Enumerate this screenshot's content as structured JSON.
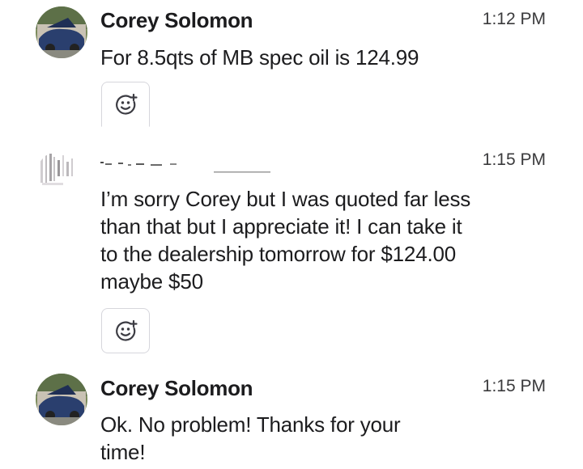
{
  "messages": [
    {
      "sender": "Corey Solomon",
      "time": "1:12 PM",
      "text": "For 8.5qts of MB spec oil is 124.99",
      "reaction_icon": "add-reaction-icon"
    },
    {
      "sender": "",
      "time": "1:15 PM",
      "text": "I’m sorry Corey but I was quoted far less than that but I appreciate it! I can take it to the dealership tomorrow for $124.00 maybe $50",
      "reaction_icon": "add-reaction-icon"
    },
    {
      "sender": "Corey Solomon",
      "time": "1:15 PM",
      "text": "Ok. No problem! Thanks for your time!"
    }
  ],
  "colors": {
    "text": "#1c1c1e",
    "timestamp": "#3a3a3c",
    "reaction_border": "#d6d6dc",
    "reaction_icon": "#3c3c43"
  }
}
